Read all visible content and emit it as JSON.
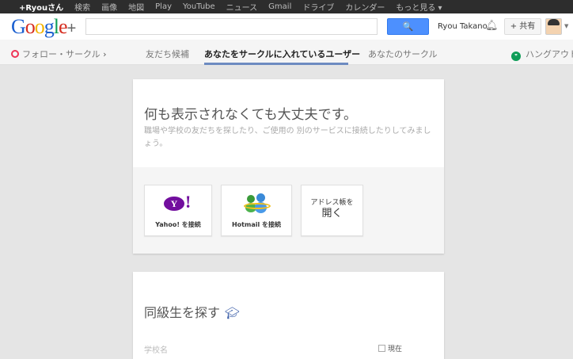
{
  "topbar": {
    "items": [
      "+Ryouさん",
      "検索",
      "画像",
      "地図",
      "Play",
      "YouTube",
      "ニュース",
      "Gmail",
      "ドライブ",
      "カレンダー",
      "もっと見る ▾"
    ]
  },
  "header": {
    "logo": "Google",
    "logo_plus": "+",
    "search_icon": "🔍",
    "user_name": "Ryou Takano",
    "share_label": "+ 共有"
  },
  "subnav": {
    "follow": "フォロー・サークル",
    "tabs": [
      "友だち候補",
      "あなたをサークルに入れているユーザー",
      "あなたのサークル"
    ],
    "active_tab": 1,
    "hangout": "ハングアウト"
  },
  "card1": {
    "title": "何も表示されなくても大丈夫です。",
    "desc": "職場や学校の友だちを探したり、ご使用の 別のサービスに接続したりしてみましょう。",
    "yahoo_logo": "Y!",
    "yahoo_label": "Yahoo! を接続",
    "hotmail_label": "Hotmail を接続",
    "address_line1": "アドレス帳を",
    "address_line2": "開く"
  },
  "card2": {
    "title": "同級生を探す",
    "school_placeholder": "学校名",
    "current_label": "現在"
  },
  "colors": {
    "accent": "#4d90fe",
    "topbar": "#2d2d2d",
    "yahoo": "#720e9e",
    "underline": "#6d8bc1"
  }
}
